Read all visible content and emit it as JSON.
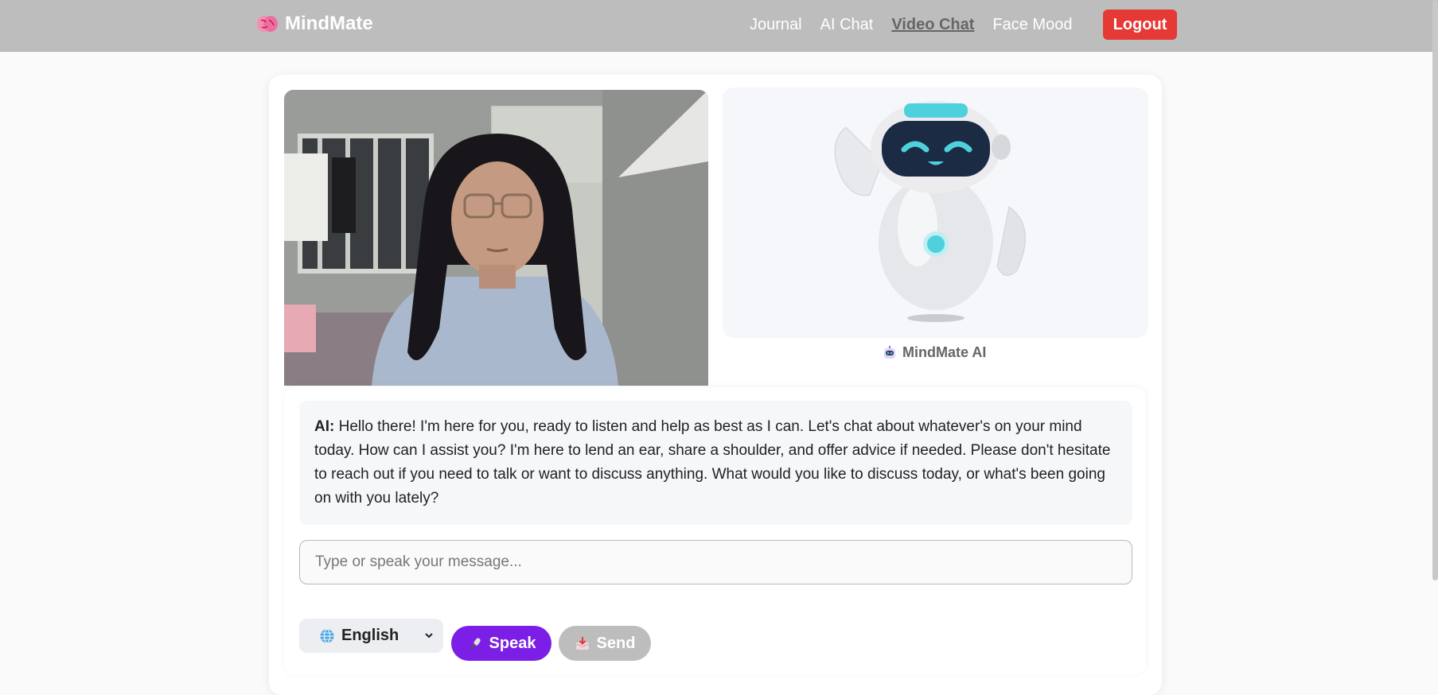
{
  "navbar": {
    "brand": "MindMate",
    "links": [
      "Journal",
      "AI Chat",
      "Video Chat",
      "Face Mood"
    ],
    "active_link": "Video Chat",
    "logout_label": "Logout"
  },
  "avatar_panel": {
    "label": "MindMate AI"
  },
  "chat": {
    "speaker": "AI:",
    "message": "Hello there! I'm here for you, ready to listen and help as best as I can. Let's chat about whatever's on your mind today. How can I assist you? I'm here to lend an ear, share a shoulder, and offer advice if needed. Please don't hesitate to reach out if you need to talk or want to discuss anything. What would you like to discuss today, or what's been going on with you lately?",
    "input_placeholder": "Type or speak your message...",
    "input_value": ""
  },
  "controls": {
    "language": "English",
    "speak_label": "Speak",
    "send_label": "Send"
  },
  "colors": {
    "navbar": "#bdbdbd",
    "logout": "#e53935",
    "speak": "#7b1fe6",
    "send_disabled": "#bdbdbd",
    "robot_accent": "#4fd1dd"
  },
  "icons": {
    "brand": "brain-icon",
    "ai_label": "robot-icon",
    "language": "globe-icon",
    "speak": "microphone-icon",
    "send": "inbox-tray-icon"
  }
}
